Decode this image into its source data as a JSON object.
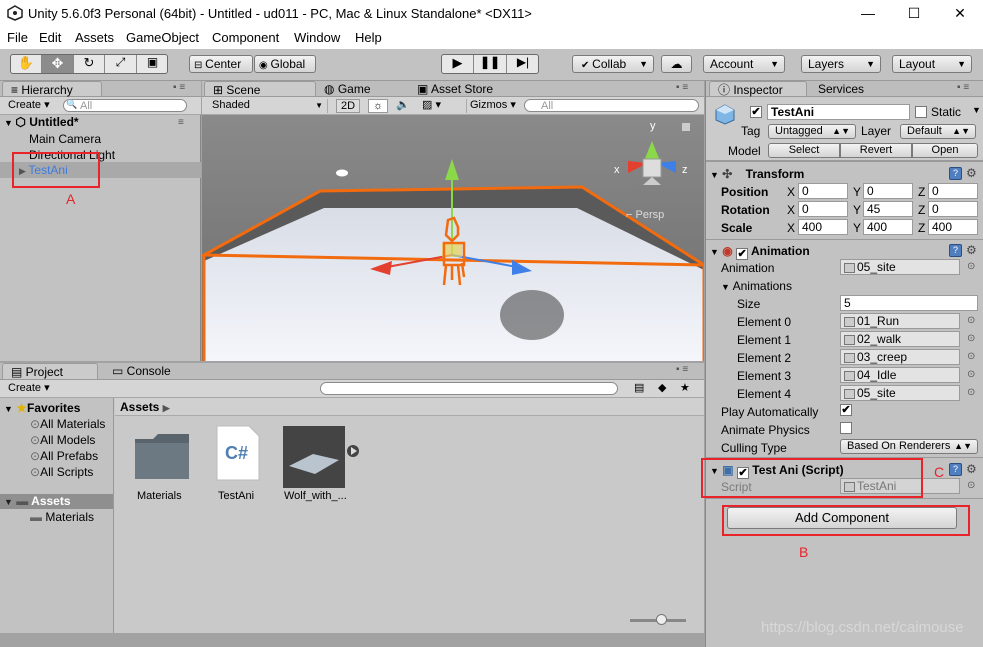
{
  "window": {
    "title": "Unity 5.6.0f3 Personal (64bit) - Untitled - ud011 - PC, Mac & Linux Standalone* <DX11>",
    "min": "—",
    "max": "☐",
    "close": "✕"
  },
  "menu": [
    "File",
    "Edit",
    "Assets",
    "GameObject",
    "Component",
    "Window",
    "Help"
  ],
  "toolbar": {
    "center": "Center",
    "global": "Global",
    "collab": "Collab",
    "account": "Account",
    "layers": "Layers",
    "layout": "Layout"
  },
  "hierarchy": {
    "tab": "Hierarchy",
    "create": "Create",
    "search_placeholder": "All",
    "scene": "Untitled*",
    "items": [
      "Main Camera",
      "Directional Light",
      "TestAni"
    ]
  },
  "scene": {
    "tabs": {
      "scene": "Scene",
      "game": "Game",
      "store": "Asset Store"
    },
    "shading": "Shaded",
    "mode2d": "2D",
    "gizmos": "Gizmos",
    "search_placeholder": "All",
    "persp": "Persp",
    "axes": {
      "x": "x",
      "y": "y",
      "z": "z"
    }
  },
  "project": {
    "tabs": {
      "project": "Project",
      "console": "Console"
    },
    "create": "Create",
    "favorites": "Favorites",
    "fav_items": [
      "All Materials",
      "All Models",
      "All Prefabs",
      "All Scripts"
    ],
    "assets": "Assets",
    "asset_children": [
      "Materials"
    ],
    "breadcrumb": "Assets",
    "files": [
      "Materials",
      "TestAni",
      "Wolf_with_..."
    ],
    "cs_glyph": "C#"
  },
  "inspector": {
    "tabs": {
      "inspector": "Inspector",
      "services": "Services"
    },
    "object_name": "TestAni",
    "static_label": "Static",
    "tag_label": "Tag",
    "tag_value": "Untagged",
    "layer_label": "Layer",
    "layer_value": "Default",
    "model_label": "Model",
    "model_buttons": [
      "Select",
      "Revert",
      "Open"
    ],
    "transform": {
      "title": "Transform",
      "position": {
        "label": "Position",
        "x": "0",
        "y": "0",
        "z": "0"
      },
      "rotation": {
        "label": "Rotation",
        "x": "0",
        "y": "45",
        "z": "0"
      },
      "scale": {
        "label": "Scale",
        "x": "400",
        "y": "400",
        "z": "400"
      },
      "axis_x": "X",
      "axis_y": "Y",
      "axis_z": "Z"
    },
    "animation": {
      "title": "Animation",
      "anim_label": "Animation",
      "anim_value": "05_site",
      "anims_label": "Animations",
      "size_label": "Size",
      "size_value": "5",
      "elements": [
        {
          "label": "Element 0",
          "value": "01_Run"
        },
        {
          "label": "Element 1",
          "value": "02_walk"
        },
        {
          "label": "Element 2",
          "value": "03_creep"
        },
        {
          "label": "Element 3",
          "value": "04_Idle"
        },
        {
          "label": "Element 4",
          "value": "05_site"
        }
      ],
      "play_auto_label": "Play Automatically",
      "play_auto": true,
      "physics_label": "Animate Physics",
      "physics": false,
      "culling_label": "Culling Type",
      "culling_value": "Based On Renderers"
    },
    "script": {
      "title": "Test Ani (Script)",
      "script_label": "Script",
      "script_value": "TestAni"
    },
    "add_component": "Add Component"
  },
  "annotations": {
    "a": "A",
    "b": "B",
    "c": "C"
  },
  "watermark": "https://blog.csdn.net/caimouse",
  "colors": {
    "selection": "#3e7de0",
    "annotation": "#e8232a",
    "orange_outline": "#f26b0f"
  }
}
